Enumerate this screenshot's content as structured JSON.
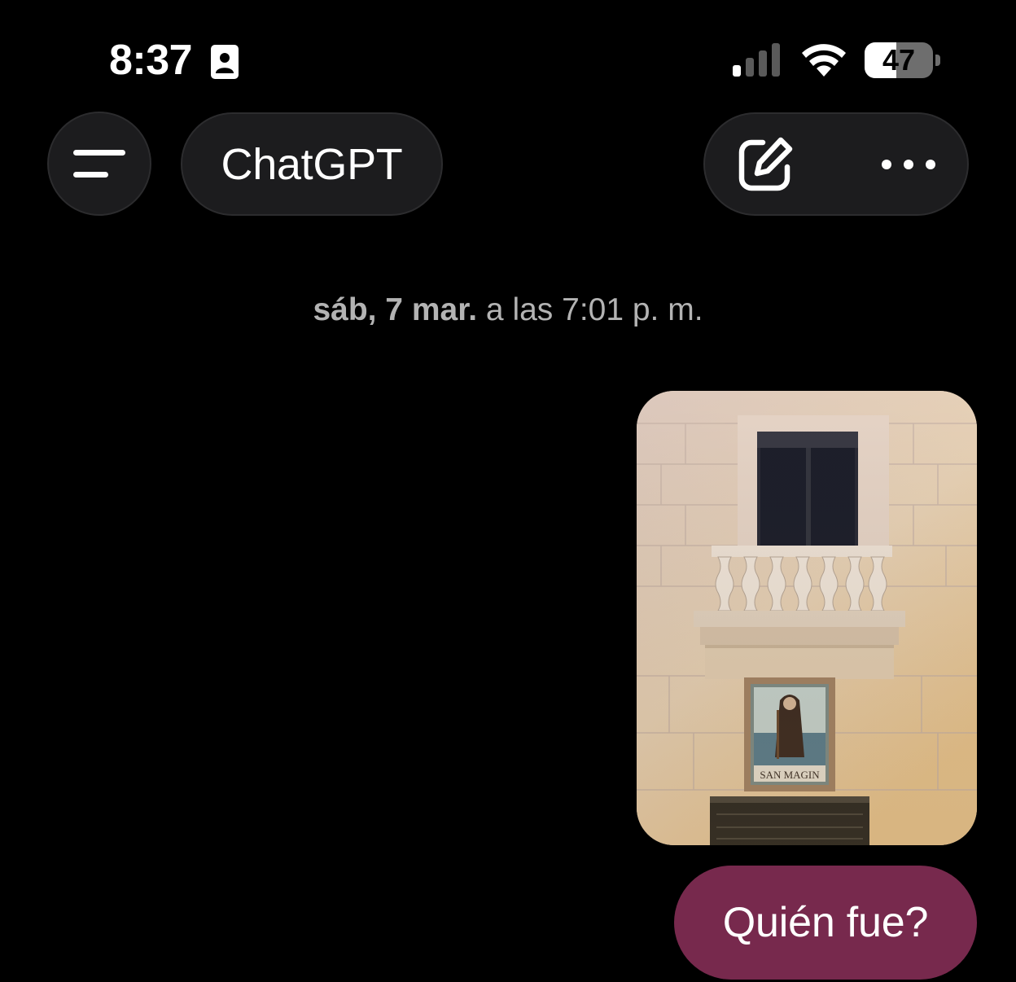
{
  "status_bar": {
    "time": "8:37",
    "battery_percent": 47,
    "battery_label": "47",
    "icons": [
      "contact-card-icon",
      "signal-icon",
      "wifi-icon",
      "battery-icon"
    ]
  },
  "header": {
    "title": "ChatGPT",
    "icons": [
      "menu-icon",
      "edit-icon",
      "more-icon"
    ]
  },
  "conversation": {
    "timestamp_date": "sáb, 7 mar.",
    "timestamp_time": " a las 7:01 p. m.",
    "image_caption_in_photo": "SAN MAGIN",
    "messages": [
      {
        "role": "user",
        "type": "image"
      },
      {
        "role": "user",
        "type": "text",
        "text": "Quién fue?"
      }
    ]
  },
  "colors": {
    "background": "#000000",
    "pill": "#1c1c1e",
    "user_bubble": "#77294d",
    "timestamp": "#b3b3b3"
  }
}
